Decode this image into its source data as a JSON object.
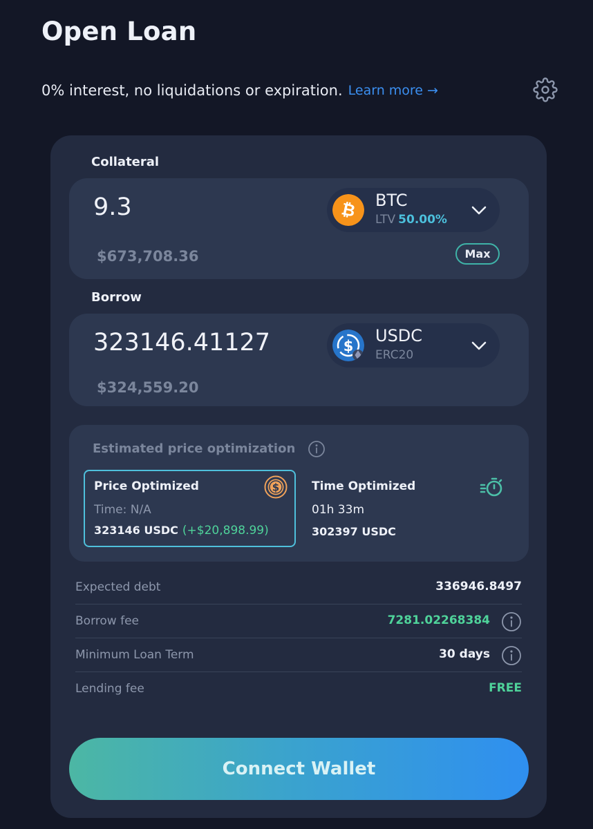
{
  "header": {
    "title": "Open Loan",
    "subtitle": "0% interest, no liquidations or expiration.",
    "learn_more": "Learn more →",
    "settings_icon": "gear-icon"
  },
  "collateral": {
    "label": "Collateral",
    "amount": "9.3",
    "usd_value": "$673,708.36",
    "token": {
      "symbol": "BTC",
      "ltv_label": "LTV",
      "ltv_value": "50.00%",
      "icon": "bitcoin-icon",
      "color": "#f7931a"
    },
    "max_label": "Max"
  },
  "borrow": {
    "label": "Borrow",
    "amount": "323146.41127",
    "usd_value": "$324,559.20",
    "token": {
      "symbol": "USDC",
      "network": "ERC20",
      "icon": "usdc-icon",
      "color": "#2775ca"
    }
  },
  "optimization": {
    "title": "Estimated price optimization",
    "options": [
      {
        "name": "Price Optimized",
        "time": "Time: N/A",
        "amount": "323146 USDC",
        "gain": "(+$20,898.99)",
        "selected": true,
        "icon": "dollar-coin-icon"
      },
      {
        "name": "Time Optimized",
        "time": "01h 33m",
        "amount": "302397 USDC",
        "selected": false,
        "icon": "stopwatch-icon"
      }
    ]
  },
  "details": [
    {
      "label": "Expected debt",
      "value": "336946.8497"
    },
    {
      "label": "Borrow fee",
      "value": "7281.02268384"
    },
    {
      "label": "Minimum Loan Term",
      "value": "30 days"
    },
    {
      "label": "Lending fee",
      "value": "FREE"
    }
  ],
  "cta": {
    "label": "Connect Wallet"
  },
  "colors": {
    "background": "#131726",
    "card": "#232b40",
    "panel": "#2d3850",
    "accent_blue": "#3b8ff0",
    "accent_green": "#4fd39a",
    "accent_cyan": "#4cc0dc"
  }
}
